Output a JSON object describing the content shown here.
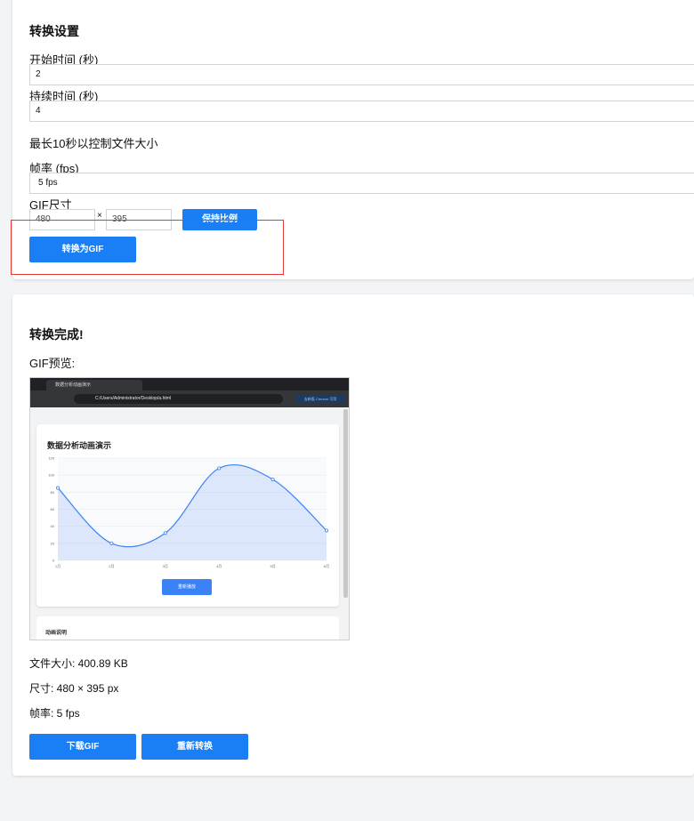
{
  "settings": {
    "title": "转换设置",
    "start_time_label": "开始时间 (秒)",
    "start_time_value": "2",
    "duration_label": "持续时间 (秒)",
    "duration_value": "4",
    "duration_hint": "最长10秒以控制文件大小",
    "fps_label": "帧率 (fps)",
    "fps_selected": "5 fps",
    "size_label": "GIF尺寸",
    "width_value": "480",
    "times_sign": "×",
    "height_value": "395",
    "keep_ratio_button": "保持比例",
    "convert_button": "转换为GIF"
  },
  "result": {
    "title": "转换完成!",
    "preview_label": "GIF预览:",
    "file_size": "文件大小: 400.89 KB",
    "dimensions": "尺寸: 480 × 395 px",
    "fps": "帧率: 5 fps",
    "download_button": "下载GIF",
    "reconvert_button": "重新转换"
  },
  "gif_preview": {
    "tab_title": "数据分析动画演示",
    "url": "C:/Users/Administrator/Desktop/a.html",
    "chip_text": "去新版 Chrome 可用",
    "chart_title": "数据分析动画演示",
    "replay_button": "重新播放",
    "note_title": "动画说明",
    "chart_data": {
      "type": "area",
      "categories": [
        "1月",
        "2月",
        "3月",
        "4月",
        "5月",
        "6月"
      ],
      "values": [
        85,
        20,
        32,
        108,
        95,
        35
      ],
      "ylim": [
        0,
        120
      ],
      "yticks": [
        "120",
        "100",
        "80",
        "60",
        "40",
        "20",
        "0"
      ]
    }
  },
  "colors": {
    "accent": "#1a7ef5",
    "highlight": "#e53935"
  }
}
